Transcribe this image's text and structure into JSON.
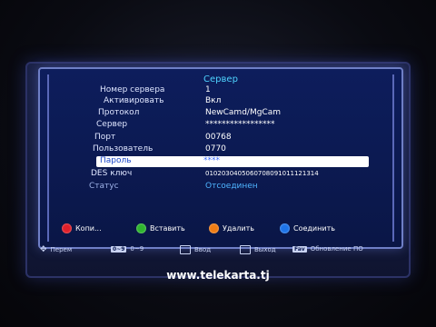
{
  "menu": {
    "title": "Сервер",
    "rows": [
      {
        "label": "Номер сервера",
        "value": "1"
      },
      {
        "label": "Активировать",
        "value": "Вкл"
      },
      {
        "label": "Протокол",
        "value": "NewCamd/MgCam"
      },
      {
        "label": "Сервер",
        "value": "*****************"
      },
      {
        "label": "Порт",
        "value": "00768"
      },
      {
        "label": "Пользователь",
        "value": "0770"
      },
      {
        "label": "Пароль",
        "value": "****"
      },
      {
        "label": "DES ключ",
        "value": "0102030405060708091011121314"
      },
      {
        "label": "Статус",
        "value": "Отсоединен"
      }
    ]
  },
  "buttons": [
    {
      "label": "Копи...",
      "color": "#e0202a"
    },
    {
      "label": "Вставить",
      "color": "#2fb52f"
    },
    {
      "label": "Удалить",
      "color": "#ef7c14"
    },
    {
      "label": "Соединить",
      "color": "#1e74e8"
    }
  ],
  "help": [
    {
      "key": "",
      "label": "Перем",
      "icon": "move-arrows-icon"
    },
    {
      "key": "0~9",
      "label": "0~9",
      "icon": "numeric-keys-icon"
    },
    {
      "key": "",
      "label": "Ввод",
      "icon": "enter-icon"
    },
    {
      "key": "",
      "label": "Выход",
      "icon": "exit-icon"
    },
    {
      "key": "Fav",
      "label": "Обновление ПО",
      "icon": "fav-key-icon"
    }
  ],
  "watermark": "www.telekarta.tj"
}
